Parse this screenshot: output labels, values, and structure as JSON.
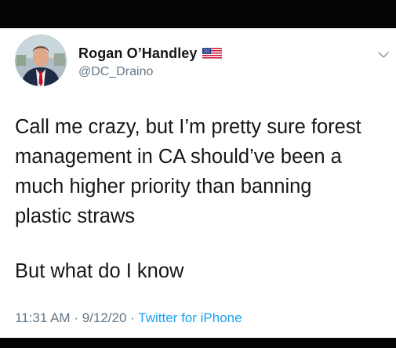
{
  "tweet": {
    "author": {
      "display_name": "Rogan O’Handley",
      "handle": "@DC_Draino",
      "flag_icon": "us-flag-icon"
    },
    "text_lines": [
      "Call me crazy, but I’m pretty sure forest",
      "management in CA should’ve been a",
      "much higher priority than banning",
      "plastic straws"
    ],
    "text_paragraph_2": "But what do I know",
    "time": "11:31 AM",
    "date": "9/12/20",
    "separator": "·",
    "source": "Twitter for iPhone"
  },
  "colors": {
    "text_primary": "#14171a",
    "text_secondary": "#657786",
    "link": "#1da1f2"
  }
}
